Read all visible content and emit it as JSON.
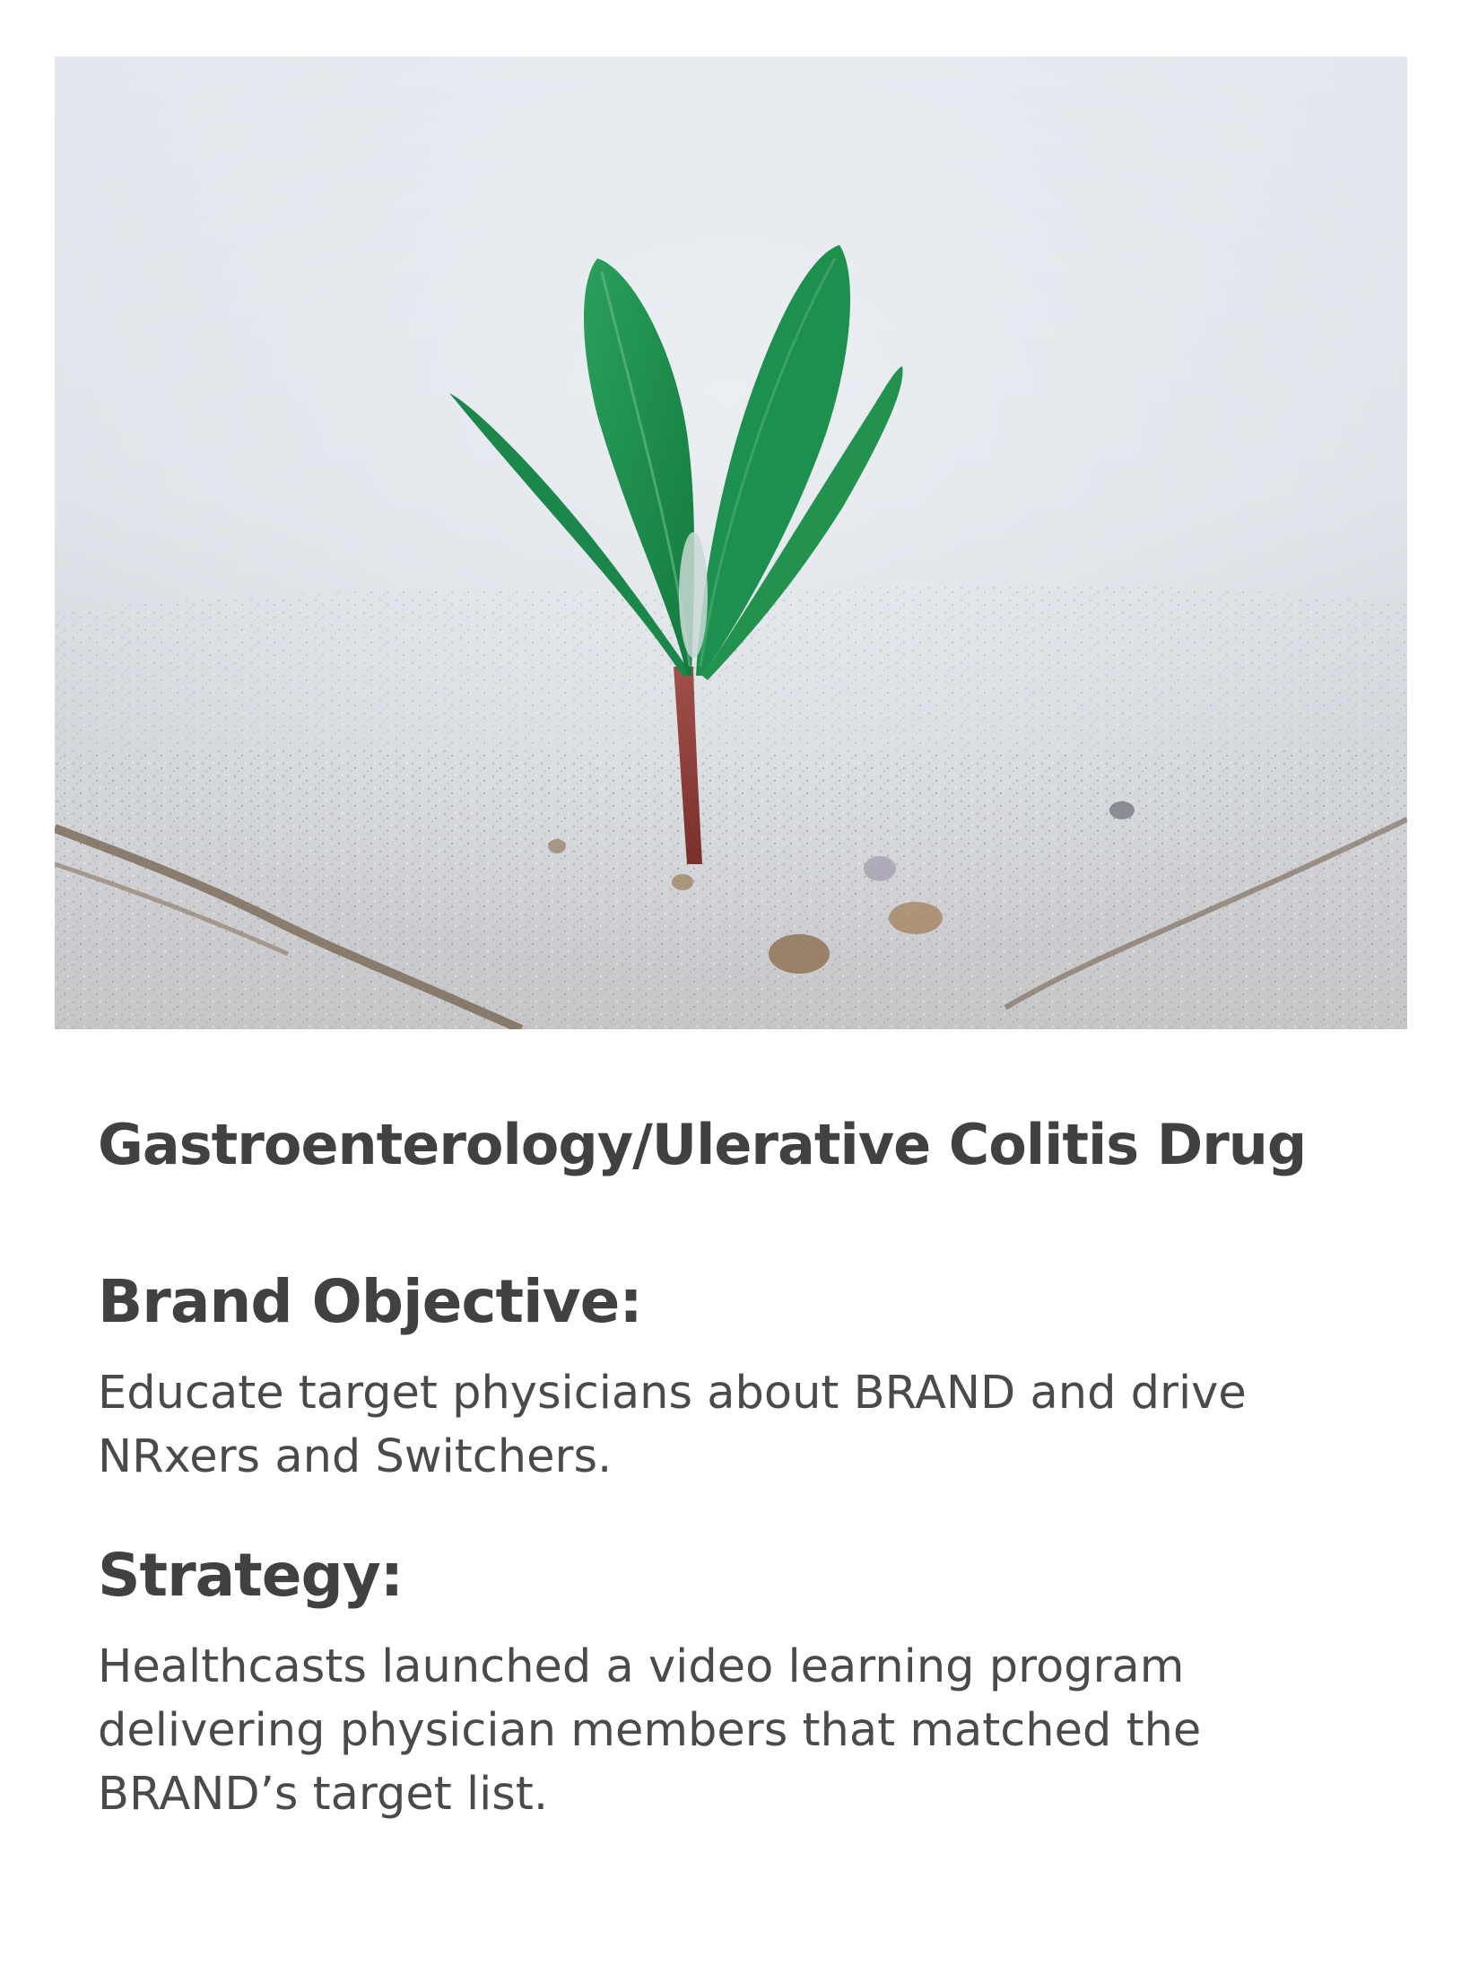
{
  "image": {
    "subject": "seedling-in-sand"
  },
  "title": "Gastroenterology/Ulerative Colitis Drug",
  "brand_objective": {
    "heading": "Brand Objective:",
    "text": "Educate target physicians about BRAND and drive NRxers and Switchers."
  },
  "strategy": {
    "heading": "Strategy:",
    "text": "Healthcasts launched a video learning program delivering physician members that matched the BRAND’s target list."
  },
  "colors": {
    "text": "#414141",
    "leaf": "#1f8a4c",
    "stem": "#8a3a36",
    "sand": "#d8dde3"
  }
}
